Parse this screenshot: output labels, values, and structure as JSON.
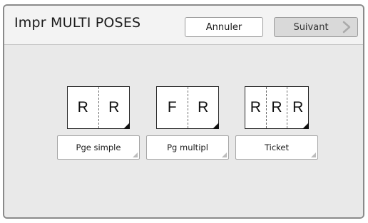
{
  "header": {
    "title": "Impr MULTI POSES",
    "cancel_label": "Annuler",
    "next_label": "Suivant"
  },
  "options": [
    {
      "letters": [
        "R",
        "R"
      ],
      "label": "Pge simple"
    },
    {
      "letters": [
        "F",
        "R"
      ],
      "label": "Pg multipl"
    },
    {
      "letters": [
        "R",
        "R",
        "R"
      ],
      "label": "Ticket"
    }
  ],
  "icons": {
    "next": "chevron-right-icon",
    "fold": "folded-corner-icon"
  }
}
